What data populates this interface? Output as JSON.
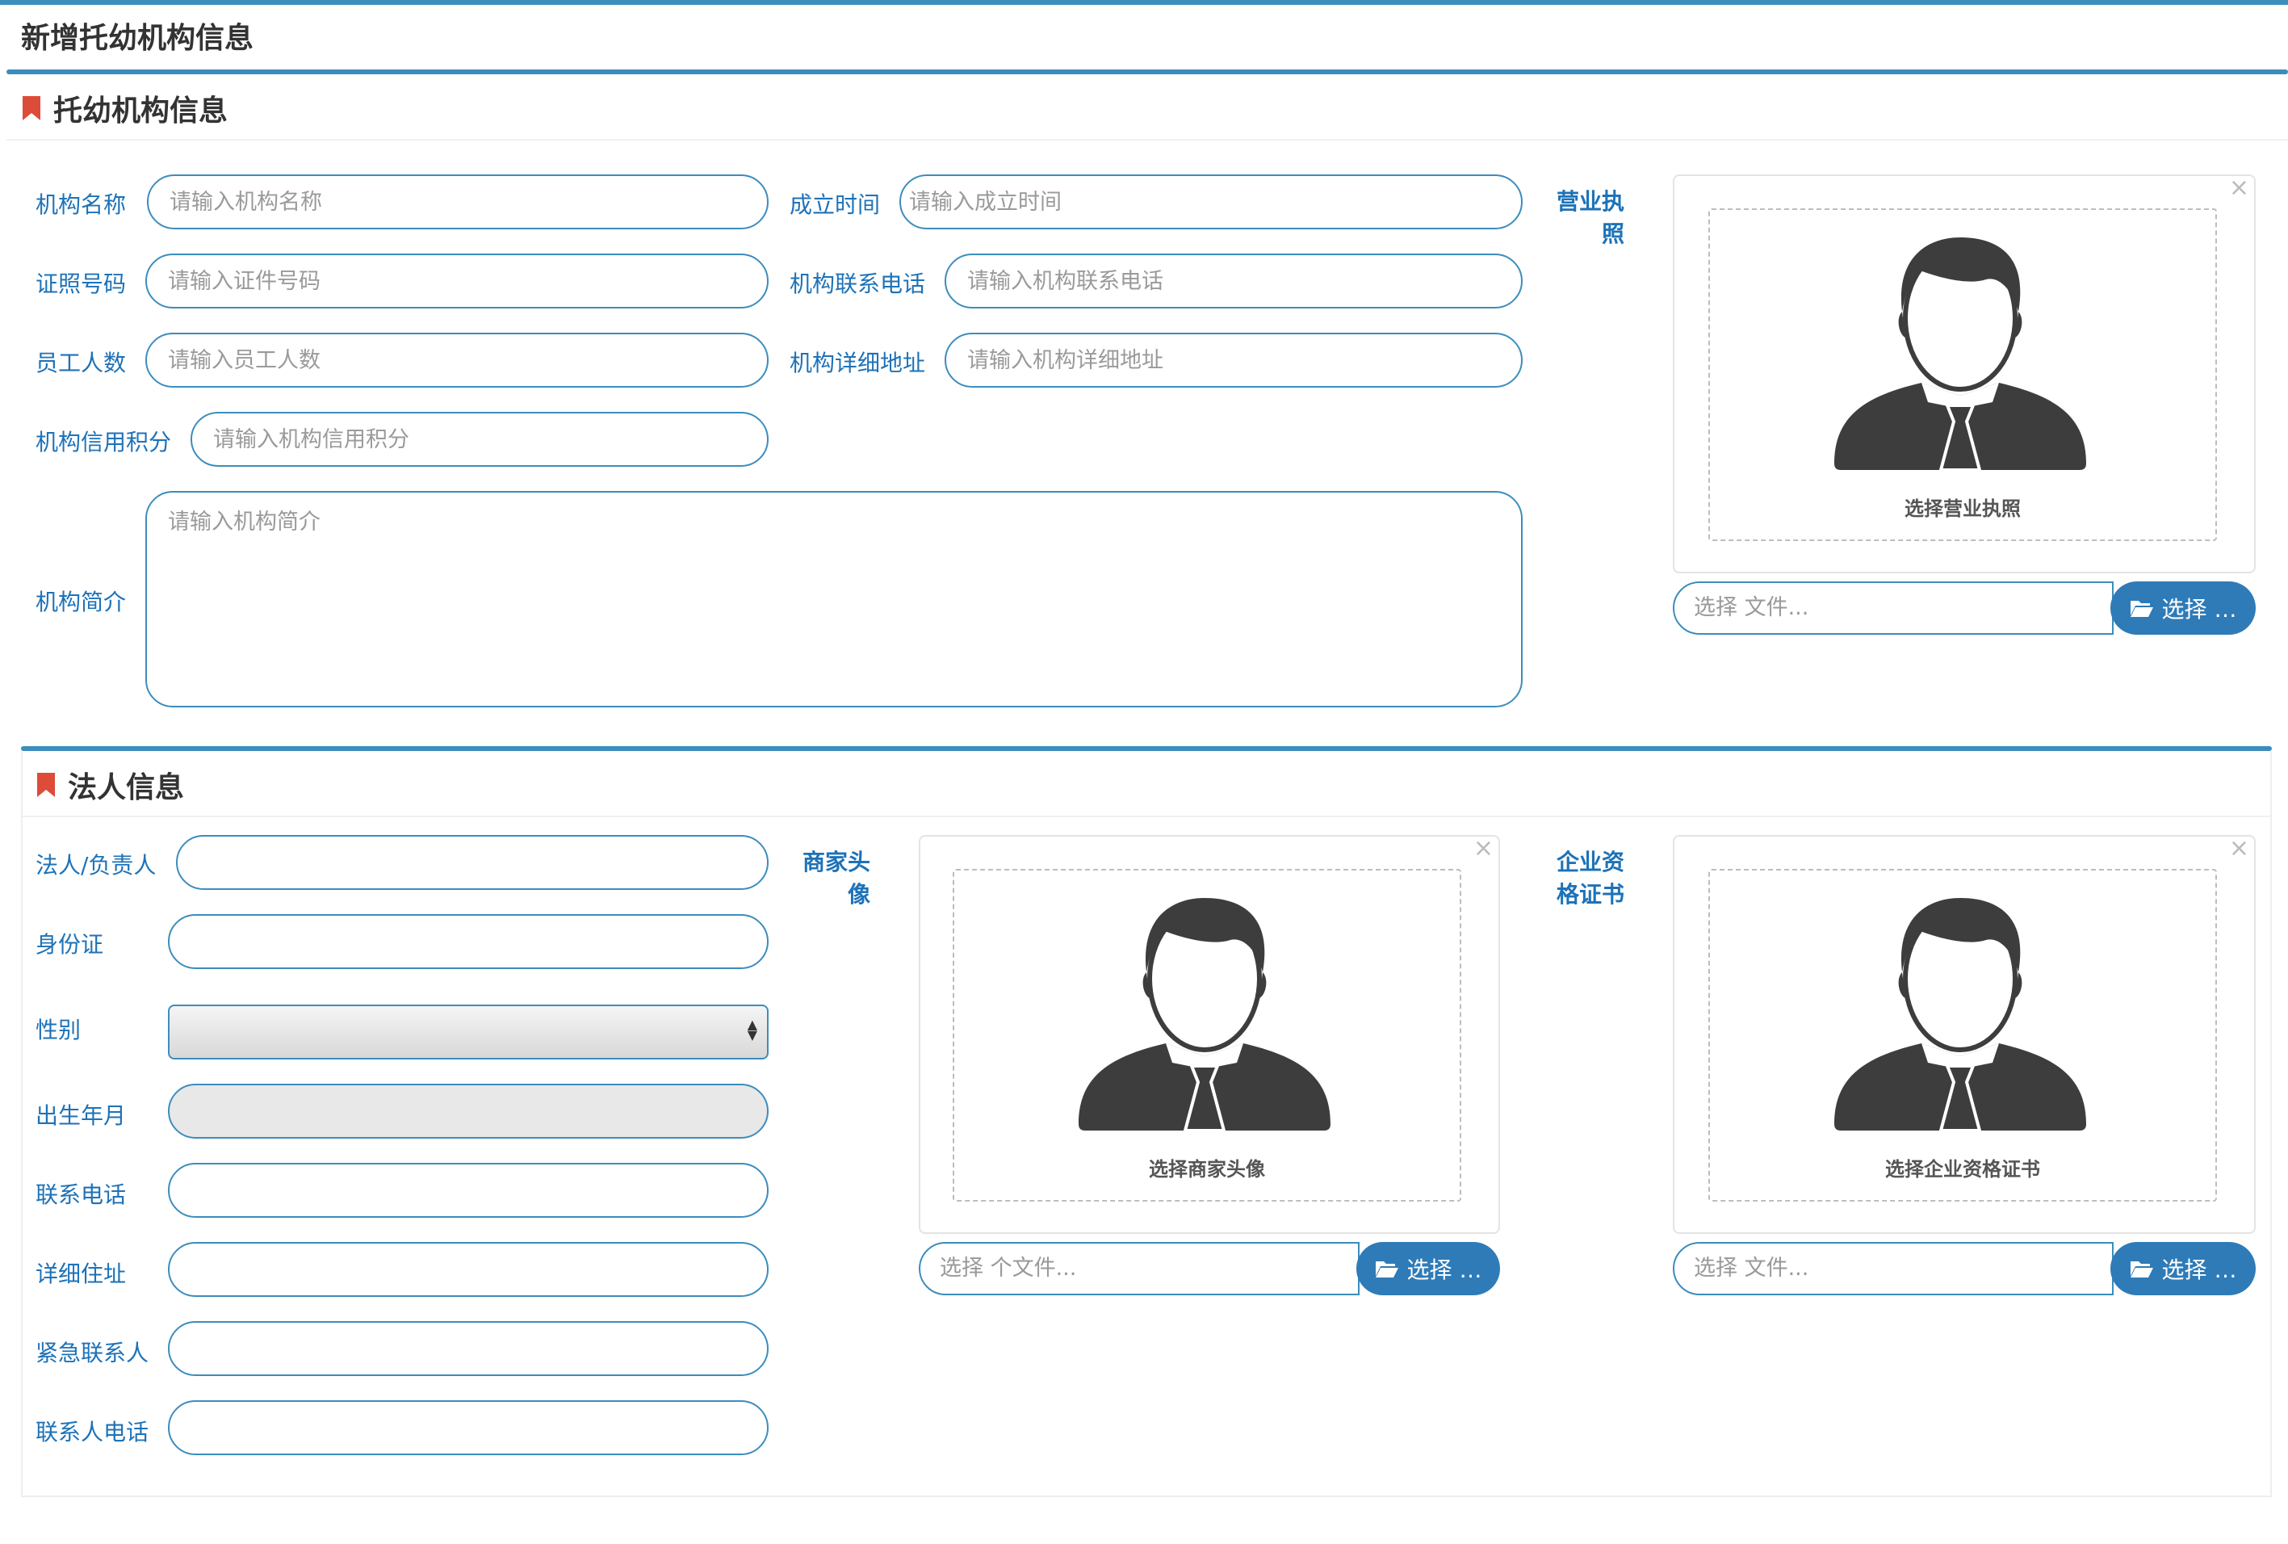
{
  "page": {
    "title": "新增托幼机构信息"
  },
  "colors": {
    "accent": "#3c8dbc",
    "label": "#1d72b8",
    "bookmark": "#dd4b39",
    "button": "#2e7bb8"
  },
  "org_section": {
    "title": "托幼机构信息",
    "fields": {
      "name": {
        "label": "机构名称",
        "placeholder": "请输入机构名称"
      },
      "established": {
        "label": "成立时间",
        "placeholder": "请输入成立时间"
      },
      "license_no": {
        "label": "证照号码",
        "placeholder": "请输入证件号码"
      },
      "phone": {
        "label": "机构联系电话",
        "placeholder": "请输入机构联系电话"
      },
      "staff": {
        "label": "员工人数",
        "placeholder": "请输入员工人数"
      },
      "address": {
        "label": "机构详细地址",
        "placeholder": "请输入机构详细地址"
      },
      "credit": {
        "label": "机构信用积分",
        "placeholder": "请输入机构信用积分"
      },
      "intro": {
        "label": "机构简介",
        "placeholder": "请输入机构简介"
      }
    },
    "license_upload": {
      "label_line1": "营业执",
      "label_line2": "照",
      "caption": "选择营业执照",
      "file_placeholder": "选择 文件...",
      "button": "选择 …",
      "remove": "×"
    }
  },
  "legal_section": {
    "title": "法人信息",
    "fields": {
      "person": {
        "label": "法人/负责人"
      },
      "id_card": {
        "label": "身份证"
      },
      "gender": {
        "label": "性别"
      },
      "birth": {
        "label": "出生年月"
      },
      "phone": {
        "label": "联系电话"
      },
      "address": {
        "label": "详细住址"
      },
      "emergency": {
        "label": "紧急联系人"
      },
      "emergency_phone": {
        "label": "联系人电话"
      }
    },
    "avatar_upload": {
      "label_line1": "商家头",
      "label_line2": "像",
      "caption": "选择商家头像",
      "file_placeholder": "选择 个文件...",
      "button": "选择 …",
      "remove": "×"
    },
    "cert_upload": {
      "label_line1": "企业资",
      "label_line2": "格证书",
      "caption": "选择企业资格证书",
      "file_placeholder": "选择 文件...",
      "button": "选择 …",
      "remove": "×"
    }
  }
}
